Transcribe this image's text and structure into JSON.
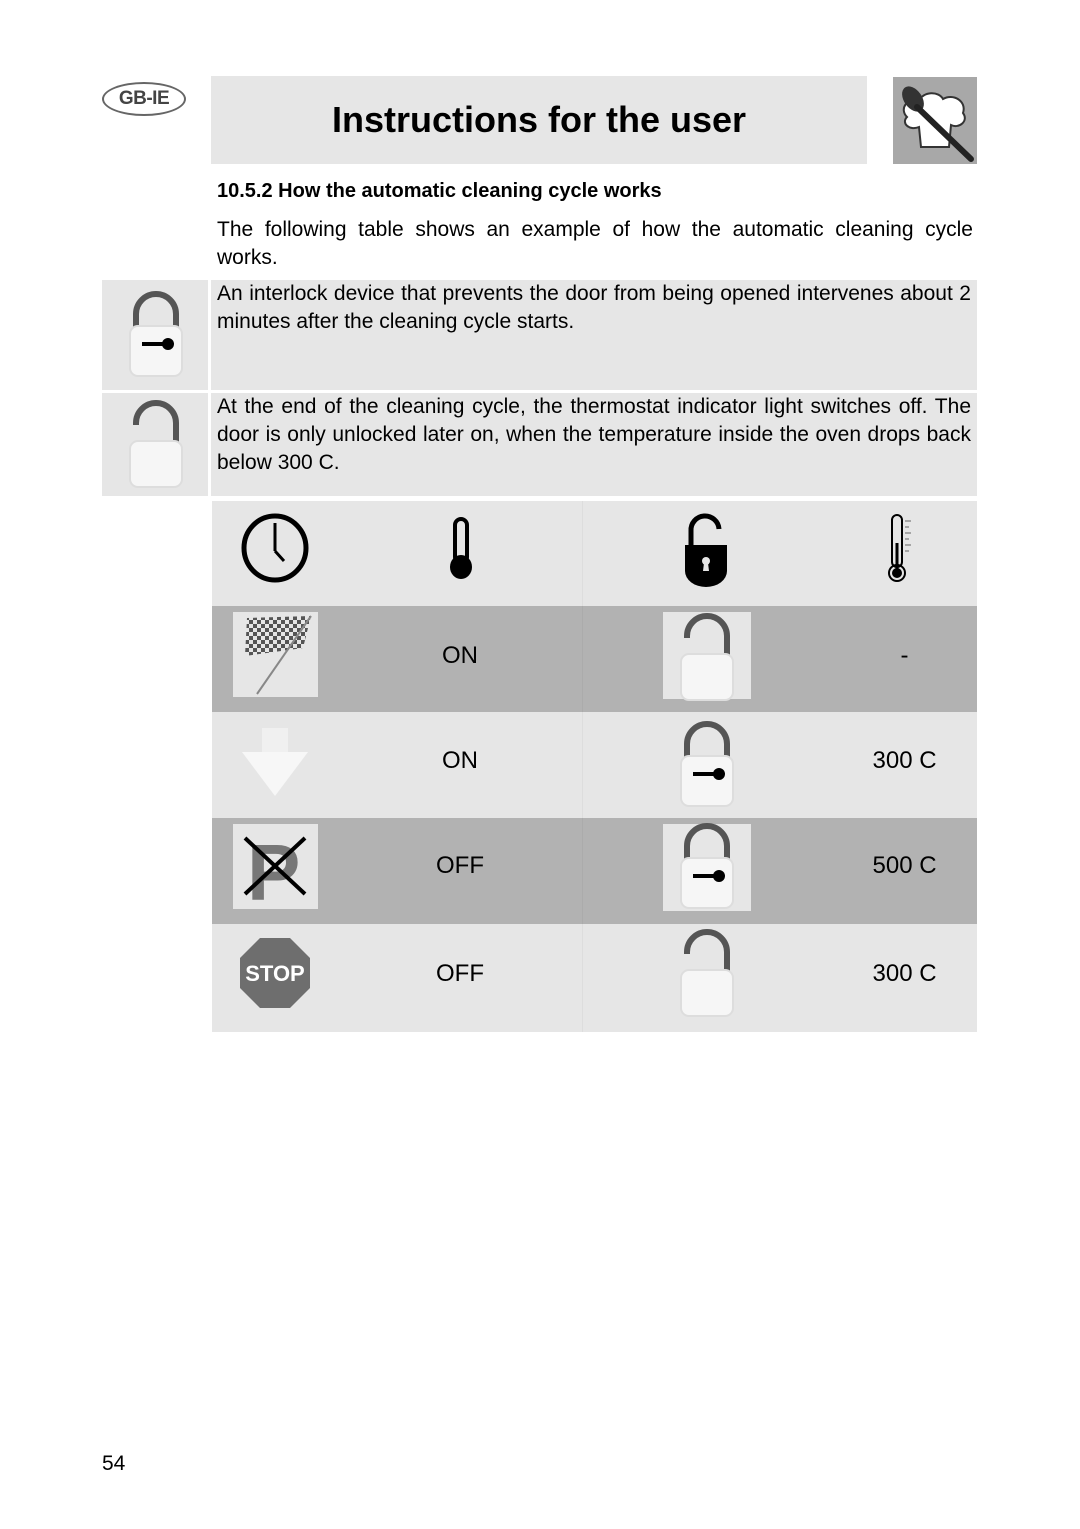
{
  "header": {
    "region_badge": "GB-IE",
    "title": "Instructions for the user"
  },
  "section": {
    "number": "10.5.2",
    "title": "How the automatic cleaning cycle works",
    "intro": "The following table shows an example of how the automatic cleaning cycle works."
  },
  "notes": [
    {
      "icon": "locked-padlock-key-icon",
      "text": "An interlock device that prevents the door from being opened intervenes about 2 minutes after the cleaning cycle starts."
    },
    {
      "icon": "unlocked-padlock-icon",
      "text": "At the end of the cleaning cycle, the thermostat indicator light switches off. The door is only unlocked later on, when the temperature inside the oven drops back below 300  C."
    }
  ],
  "table": {
    "header_icons": [
      "clock-icon",
      "thermostat-light-icon",
      "door-lock-icon",
      "oven-temperature-icon"
    ],
    "rows": [
      {
        "phase_icon": "checkered-flag-icon",
        "thermostat": "ON",
        "lock_icon": "unlocked-padlock-icon",
        "temperature": "-"
      },
      {
        "phase_icon": "down-arrow-icon",
        "thermostat": "ON",
        "lock_icon": "locked-padlock-key-icon",
        "temperature": "300  C"
      },
      {
        "phase_icon": "no-parking-icon",
        "thermostat": "OFF",
        "lock_icon": "locked-padlock-key-icon",
        "temperature": "500  C"
      },
      {
        "phase_icon": "stop-sign-icon",
        "thermostat": "OFF",
        "lock_icon": "unlocked-padlock-icon",
        "temperature": "300  C"
      }
    ],
    "stop_label": "STOP"
  },
  "footer": {
    "page_number": "54"
  }
}
